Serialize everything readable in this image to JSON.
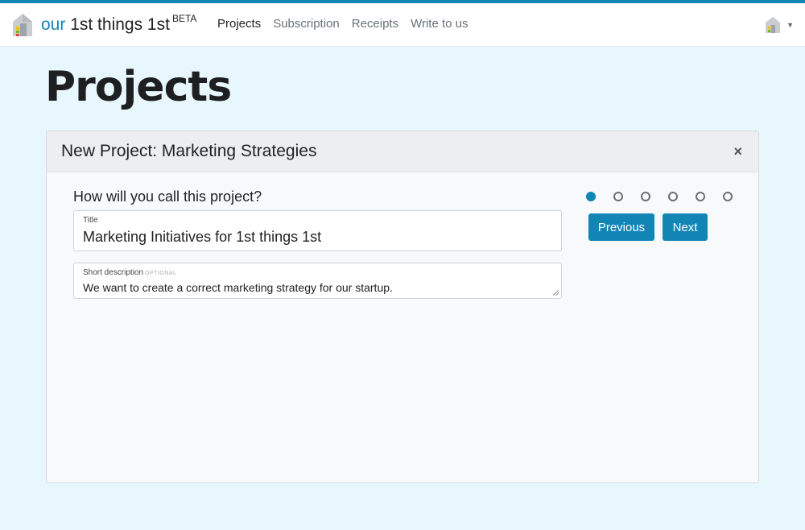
{
  "brand": {
    "our": "our",
    "rest": "1st things 1st",
    "beta": "BETA"
  },
  "nav": {
    "items": [
      "Projects",
      "Subscription",
      "Receipts",
      "Write to us"
    ],
    "active": "Projects"
  },
  "page": {
    "title": "Projects"
  },
  "card": {
    "title": "New Project: Marketing Strategies",
    "close": "×",
    "question": "How will you call this project?",
    "title_field": {
      "label": "Title",
      "value": "Marketing Initiatives for 1st things 1st"
    },
    "desc_field": {
      "label": "Short description",
      "optional": "OPTIONAL",
      "value": "We want to create a correct marketing strategy for our startup."
    },
    "steps": {
      "total": 6,
      "current": 1
    },
    "buttons": {
      "previous": "Previous",
      "next": "Next"
    }
  },
  "colors": {
    "accent": "#1186b5",
    "background": "#e8f6fd"
  }
}
